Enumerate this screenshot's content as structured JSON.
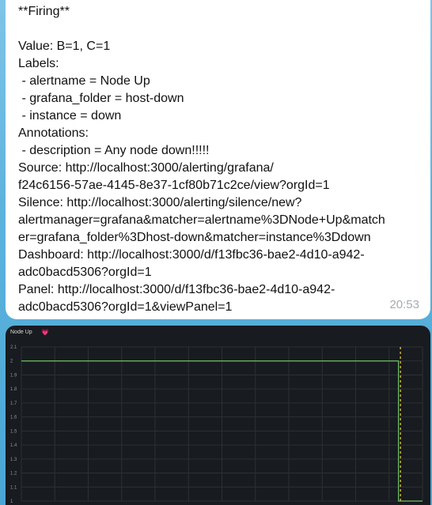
{
  "message": {
    "lines": [
      "**Firing**",
      "",
      "Value: B=1, C=1",
      "Labels:",
      " - alertname = Node Up",
      " - grafana_folder = host-down",
      " - instance = down",
      "Annotations:",
      " - description = Any node down!!!!!",
      "Source: http://localhost:3000/alerting/grafana/",
      "f24c6156-57ae-4145-8e37-1cf80b71c2ce/view?orgId=1",
      "Silence: http://localhost:3000/alerting/silence/new?",
      "alertmanager=grafana&matcher=alertname%3DNode+Up&match",
      "er=grafana_folder%3Dhost-down&matcher=instance%3Ddown",
      "Dashboard: http://localhost:3000/d/f13fbc36-bae2-4d10-a942-",
      "adc0bacd5306?orgId=1",
      "Panel: http://localhost:3000/d/f13fbc36-bae2-4d10-a942-",
      "adc0bacd5306?orgId=1&viewPanel=1"
    ],
    "time": "20:53"
  },
  "panel": {
    "title": "Node Up",
    "title_icon": "heart-icon"
  },
  "chart_data": {
    "type": "line",
    "title": "Node Up",
    "y_ticks": [
      "2.1",
      "2",
      "1.9",
      "1.8",
      "1.7",
      "1.6",
      "1.5",
      "1.4",
      "1.3",
      "1.2",
      "1.1",
      "1"
    ],
    "ylim": [
      1,
      2.1
    ],
    "grid": true,
    "series": [
      {
        "color": "#73bf69",
        "x": [
          0,
          0.94,
          0.94,
          1
        ],
        "values": [
          2,
          2,
          1,
          1
        ]
      }
    ],
    "threshold_marker": {
      "x": 0.945,
      "color": "#e0c63c",
      "style": "dashed"
    },
    "colors": {
      "background": "#181b1f",
      "grid": "#2c3035",
      "tick_text": "#8e9199"
    }
  }
}
